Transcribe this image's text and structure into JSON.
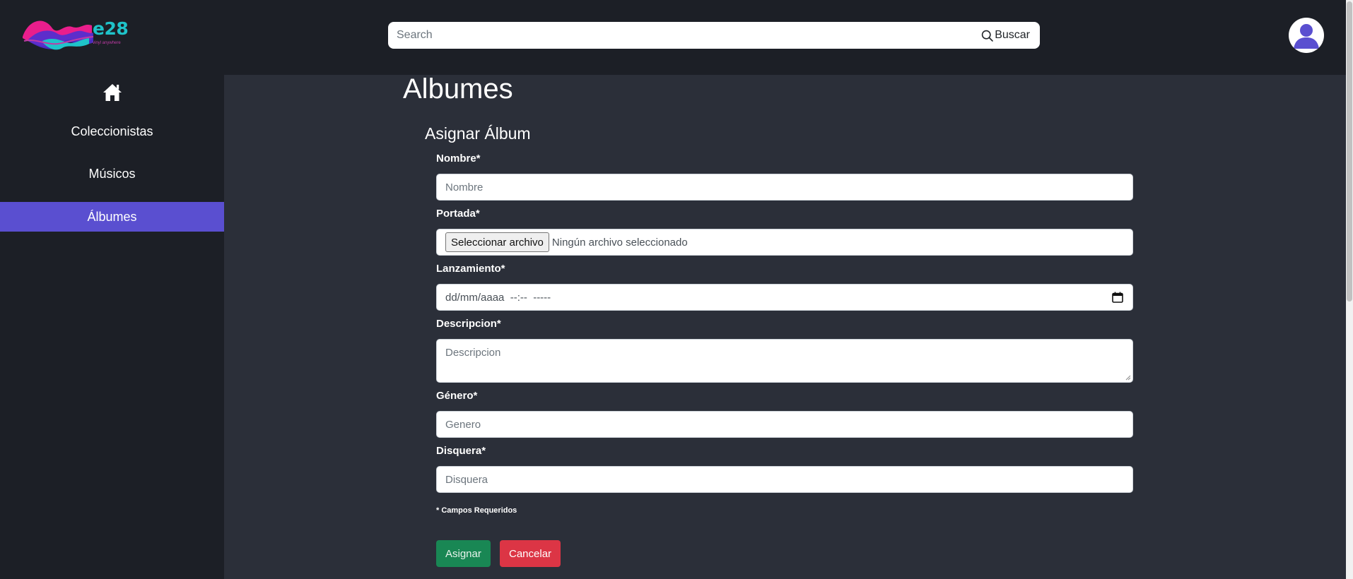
{
  "header": {
    "logo_text": "e28",
    "logo_tagline": "vinyl anywhere",
    "search_placeholder": "Search",
    "search_button_label": "Buscar"
  },
  "sidebar": {
    "items": [
      {
        "label": "Coleccionistas",
        "active": false
      },
      {
        "label": "Músicos",
        "active": false
      },
      {
        "label": "Álbumes",
        "active": true
      }
    ]
  },
  "main": {
    "page_title": "Albumes",
    "form_title": "Asignar Álbum",
    "fields": {
      "nombre": {
        "label": "Nombre*",
        "placeholder": "Nombre"
      },
      "portada": {
        "label": "Portada*",
        "button_label": "Seleccionar archivo",
        "status": "Ningún archivo seleccionado"
      },
      "lanzamiento": {
        "label": "Lanzamiento*",
        "value": "dd/mm/aaaa  --:--  -----"
      },
      "descripcion": {
        "label": "Descripcion*",
        "placeholder": "Descripcion"
      },
      "genero": {
        "label": "Género*",
        "placeholder": "Genero"
      },
      "disquera": {
        "label": "Disquera*",
        "placeholder": "Disquera"
      }
    },
    "required_note": "* Campos Requeridos",
    "assign_button": "Asignar",
    "cancel_button": "Cancelar"
  },
  "colors": {
    "bg_dark": "#1c1f26",
    "bg_main": "#2b2f39",
    "accent": "#5a4fd0",
    "success": "#198754",
    "danger": "#dc3545"
  }
}
